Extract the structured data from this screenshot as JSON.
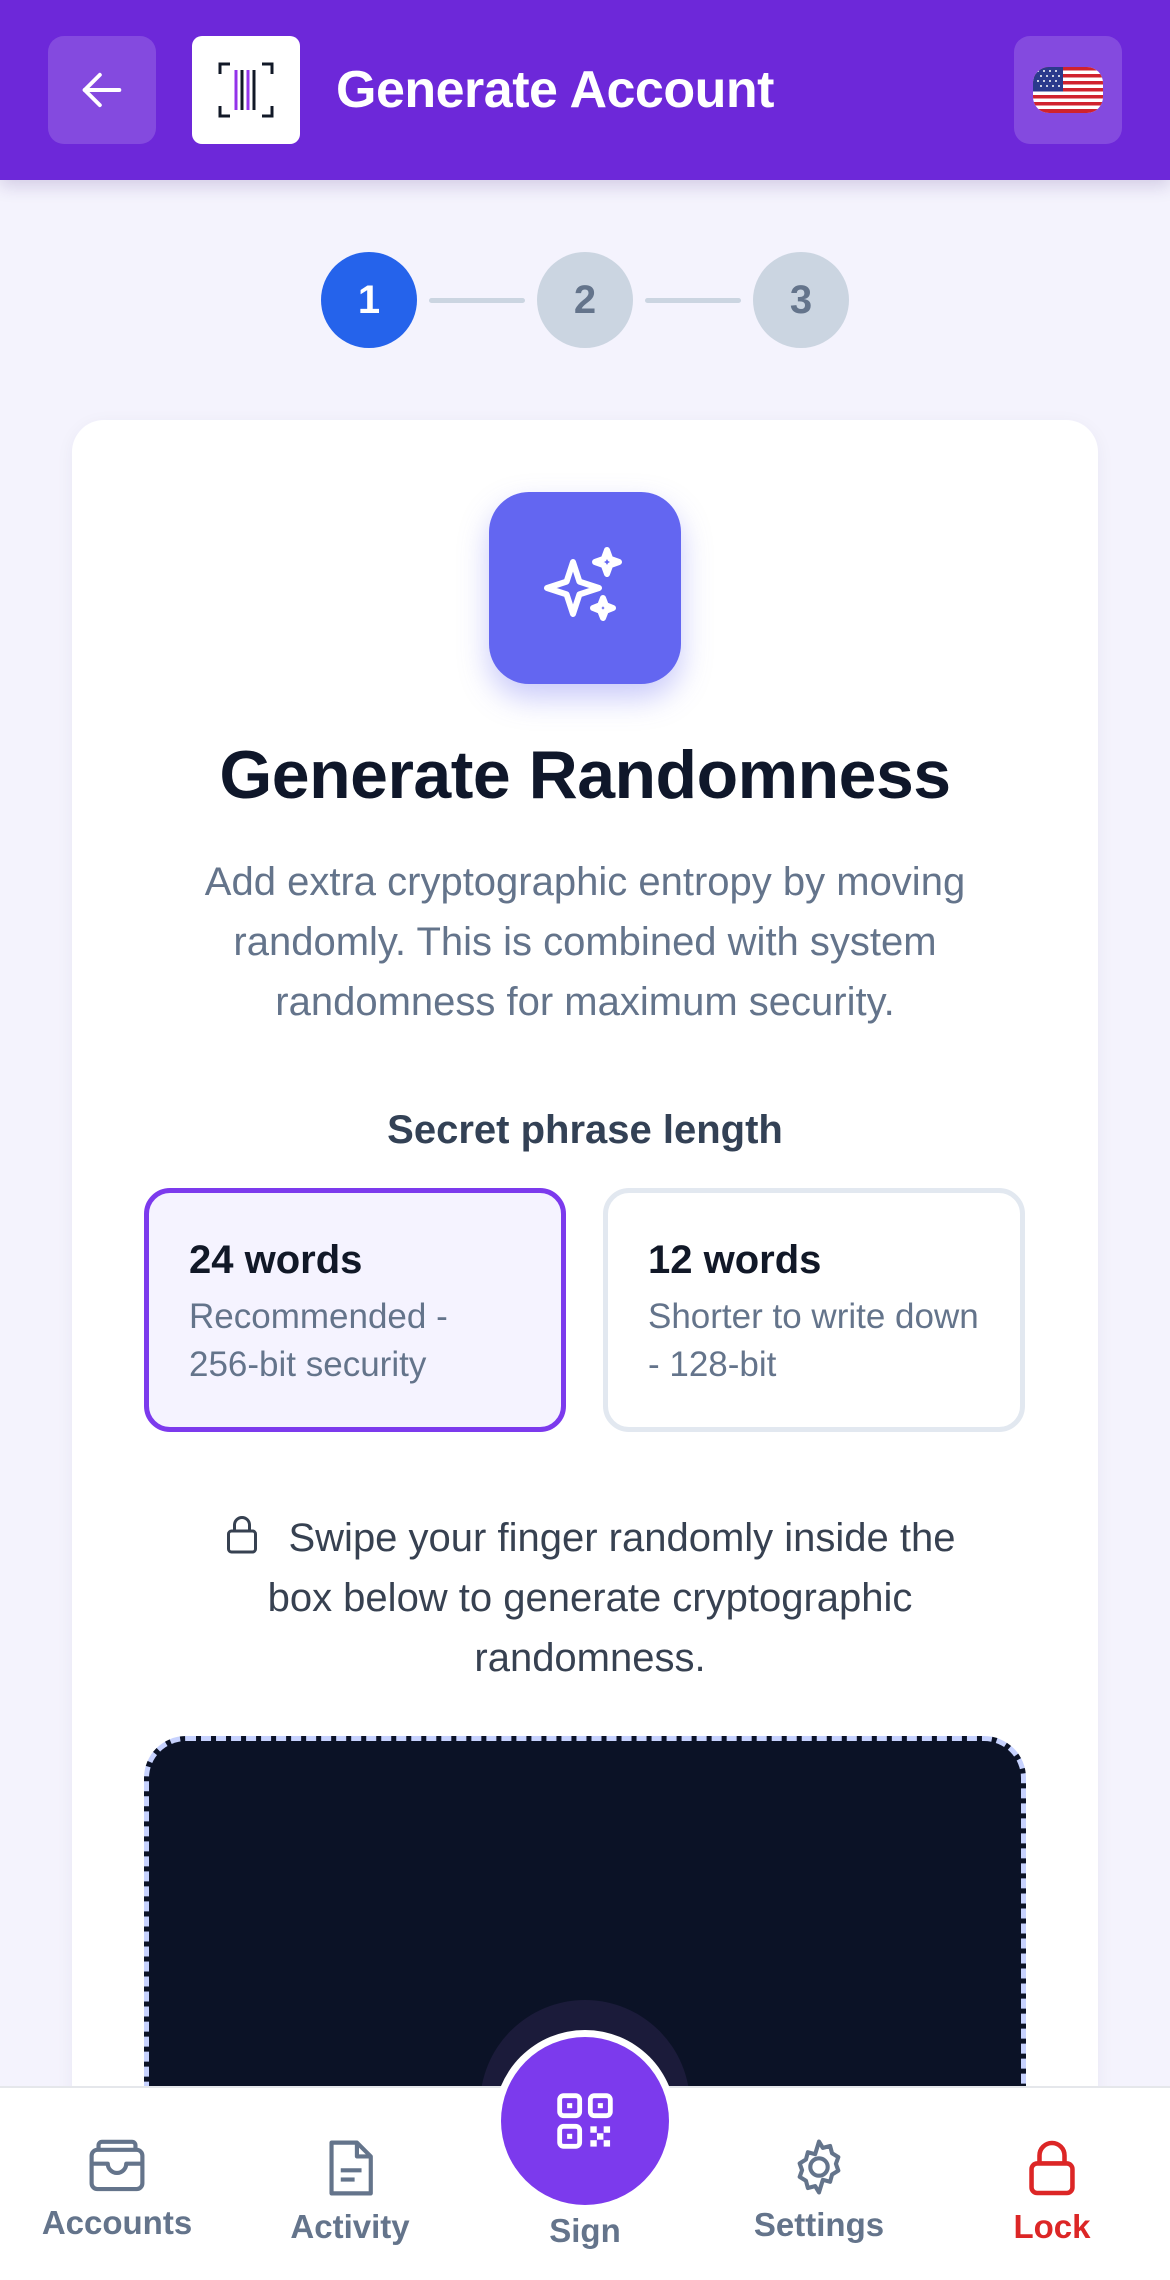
{
  "header": {
    "title": "Generate Account",
    "back_icon": "arrow-left-icon",
    "logo_icon": "barcode-logo-icon",
    "language_icon": "us-flag-icon"
  },
  "stepper": {
    "steps": [
      "1",
      "2",
      "3"
    ],
    "active_step": 1
  },
  "card": {
    "icon": "sparkles-icon",
    "heading": "Generate Randomness",
    "description": "Add extra cryptographic entropy by moving randomly. This is combined with system randomness for maximum security.",
    "length_label": "Secret phrase length",
    "options": [
      {
        "title": "24 words",
        "subtitle": "Recommended - 256-bit security",
        "selected": true
      },
      {
        "title": "12 words",
        "subtitle": "Shorter to write down - 128-bit",
        "selected": false
      }
    ],
    "hint": "Swipe your finger randomly inside the box below to generate cryptographic randomness."
  },
  "nav": {
    "items": [
      {
        "label": "Accounts",
        "icon": "wallet-icon"
      },
      {
        "label": "Activity",
        "icon": "document-icon"
      },
      {
        "label": "Sign",
        "icon": "qr-code-icon"
      },
      {
        "label": "Settings",
        "icon": "gear-icon"
      },
      {
        "label": "Lock",
        "icon": "lock-icon"
      }
    ]
  },
  "colors": {
    "header": "#6d28d9",
    "active_step": "#2563eb",
    "selected_border": "#7c3aed",
    "hero_icon_bg": "#6366f1",
    "entropy_box": "#0b1226",
    "lock_red": "#dc2626"
  }
}
